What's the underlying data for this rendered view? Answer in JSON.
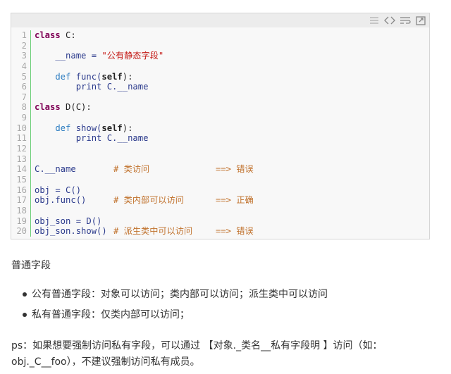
{
  "toolbar": {
    "icons": [
      "lines-icon",
      "code-icon",
      "wrap-icon",
      "popout-icon"
    ]
  },
  "code_lines": [
    {
      "n": "1",
      "parts": [
        {
          "t": "class",
          "c": "tok-kw"
        },
        {
          "t": " C:",
          "c": "tok-plain"
        }
      ]
    },
    {
      "n": "2",
      "parts": []
    },
    {
      "n": "3",
      "parts": [
        {
          "t": "    __name = ",
          "c": "tok-id"
        },
        {
          "t": "\"公有静态字段\"",
          "c": "tok-str"
        }
      ]
    },
    {
      "n": "4",
      "parts": []
    },
    {
      "n": "5",
      "parts": [
        {
          "t": "    def ",
          "c": "tok-kw2"
        },
        {
          "t": "func(",
          "c": "tok-id"
        },
        {
          "t": "self",
          "c": "tok-bold"
        },
        {
          "t": "):",
          "c": "tok-plain"
        }
      ]
    },
    {
      "n": "6",
      "parts": [
        {
          "t": "        print C.__name",
          "c": "tok-id"
        }
      ]
    },
    {
      "n": "7",
      "parts": []
    },
    {
      "n": "8",
      "parts": [
        {
          "t": "class",
          "c": "tok-kw"
        },
        {
          "t": " D(C):",
          "c": "tok-plain"
        }
      ]
    },
    {
      "n": "9",
      "parts": []
    },
    {
      "n": "10",
      "parts": [
        {
          "t": "    def ",
          "c": "tok-kw2"
        },
        {
          "t": "show(",
          "c": "tok-id"
        },
        {
          "t": "self",
          "c": "tok-bold"
        },
        {
          "t": "):",
          "c": "tok-plain"
        }
      ]
    },
    {
      "n": "11",
      "parts": [
        {
          "t": "        print C.__name",
          "c": "tok-id"
        }
      ]
    },
    {
      "n": "12",
      "parts": []
    },
    {
      "n": "13",
      "parts": []
    },
    {
      "n": "14",
      "parts": [
        {
          "t": "C.__name",
          "c": "tok-id"
        }
      ],
      "comment": "# 类访问",
      "arrow": "==> 错误"
    },
    {
      "n": "15",
      "parts": []
    },
    {
      "n": "16",
      "parts": [
        {
          "t": "obj = C()",
          "c": "tok-id"
        }
      ]
    },
    {
      "n": "17",
      "parts": [
        {
          "t": "obj.func()",
          "c": "tok-id"
        }
      ],
      "comment": "# 类内部可以访问",
      "arrow": "==> 正确"
    },
    {
      "n": "18",
      "parts": []
    },
    {
      "n": "19",
      "parts": [
        {
          "t": "obj_son = D()",
          "c": "tok-id"
        }
      ]
    },
    {
      "n": "20",
      "parts": [
        {
          "t": "obj_son.show()",
          "c": "tok-id"
        }
      ],
      "comment": "# 派生类中可以访问",
      "arrow": "==> 错误"
    }
  ],
  "section_title": "普通字段",
  "bullets": [
    "公有普通字段：对象可以访问；类内部可以访问；派生类中可以访问",
    "私有普通字段：仅类内部可以访问；"
  ],
  "ps_text": "ps：如果想要强制访问私有字段，可以通过 【对象._类名__私有字段明 】访问（如：obj._C__foo），不建议强制访问私有成员。",
  "colors": {
    "keyword": "#7f0055",
    "string": "#c41a16",
    "comment": "#c0702a",
    "identifier": "#2b3a8c",
    "gutter_border": "#6ccf78"
  }
}
